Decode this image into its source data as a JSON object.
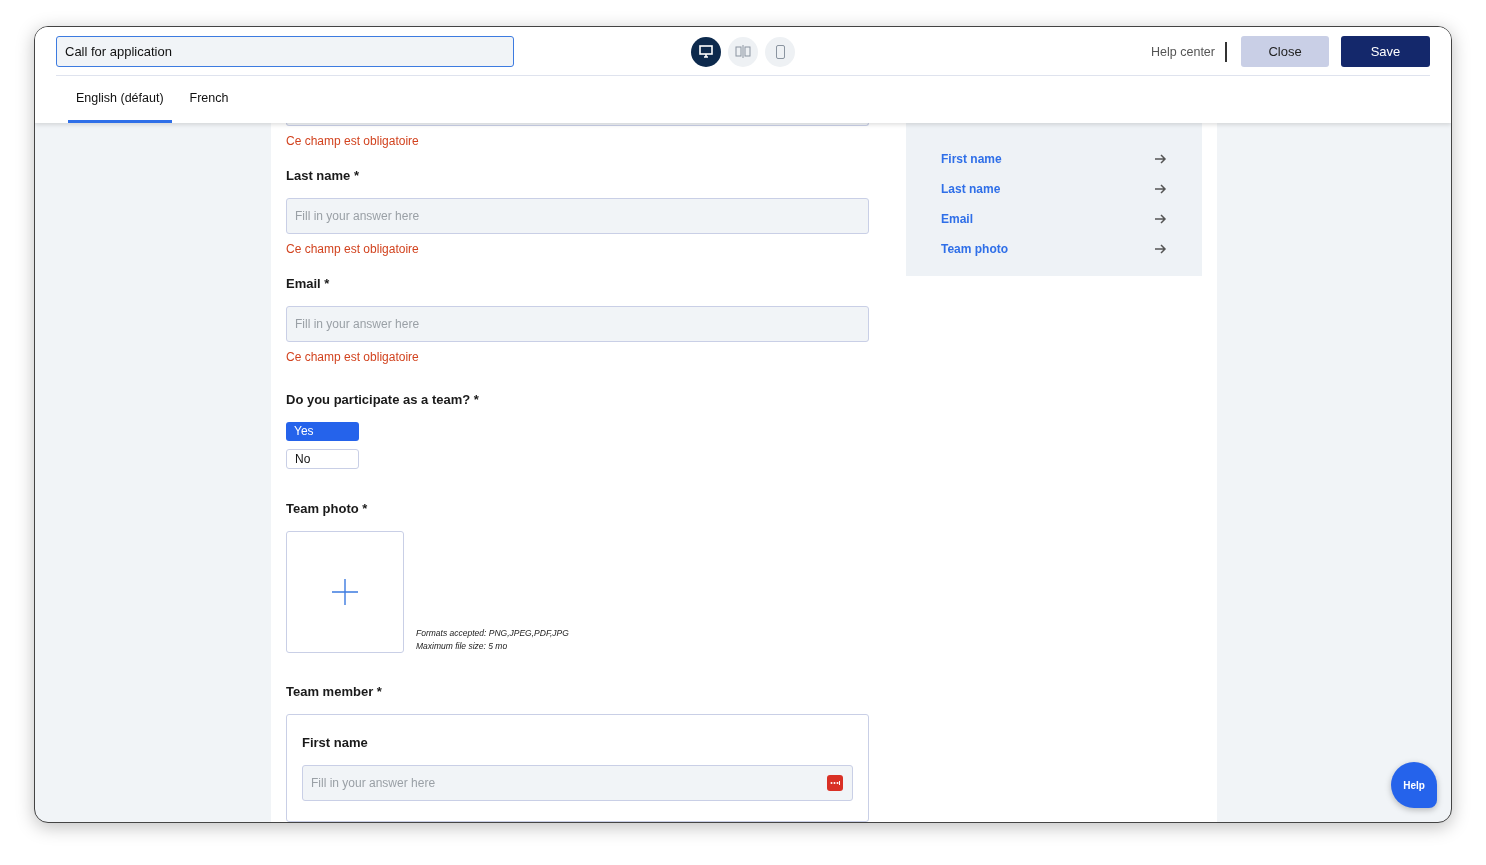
{
  "title_field": {
    "value": "Call for application"
  },
  "view_modes": [
    {
      "kind": "desktop",
      "selected": true
    },
    {
      "kind": "split",
      "selected": false
    },
    {
      "kind": "mobile",
      "selected": false
    }
  ],
  "help_link": "Help center",
  "buttons": [
    {
      "label": "Close",
      "kind": "secondary"
    },
    {
      "label": "Save",
      "kind": "primary"
    }
  ],
  "language_tabs": [
    {
      "label": "English (défaut)",
      "selected": true
    },
    {
      "label": "French",
      "selected": false
    }
  ],
  "form": {
    "top_error": "Ce champ est obligatoire",
    "fields": [
      {
        "kind": "text",
        "label": "Last name *",
        "placeholder": "Fill in your answer here",
        "error": "Ce champ est obligatoire",
        "autofill_icon": false
      },
      {
        "kind": "text",
        "label": "Email *",
        "placeholder": "Fill in your answer here",
        "error": "Ce champ est obligatoire",
        "autofill_icon": false
      },
      {
        "kind": "choice",
        "label": "Do you participate as a team? *",
        "options": [
          {
            "label": "Yes",
            "selected": true
          },
          {
            "label": "No",
            "selected": false
          }
        ]
      },
      {
        "kind": "upload",
        "label": "Team photo *",
        "hints": [
          "Formats accepted: PNG,JPEG,PDF,JPG",
          "Maximum file size: 5 mo"
        ]
      },
      {
        "kind": "group",
        "label": "Team member *",
        "fields": [
          {
            "kind": "text",
            "label": "First name",
            "placeholder": "Fill in your answer here",
            "autofill_icon": true
          }
        ]
      }
    ]
  },
  "missing_panel": {
    "items": [
      "First name",
      "Last name",
      "Email",
      "Team photo"
    ]
  },
  "help_button": "Help"
}
